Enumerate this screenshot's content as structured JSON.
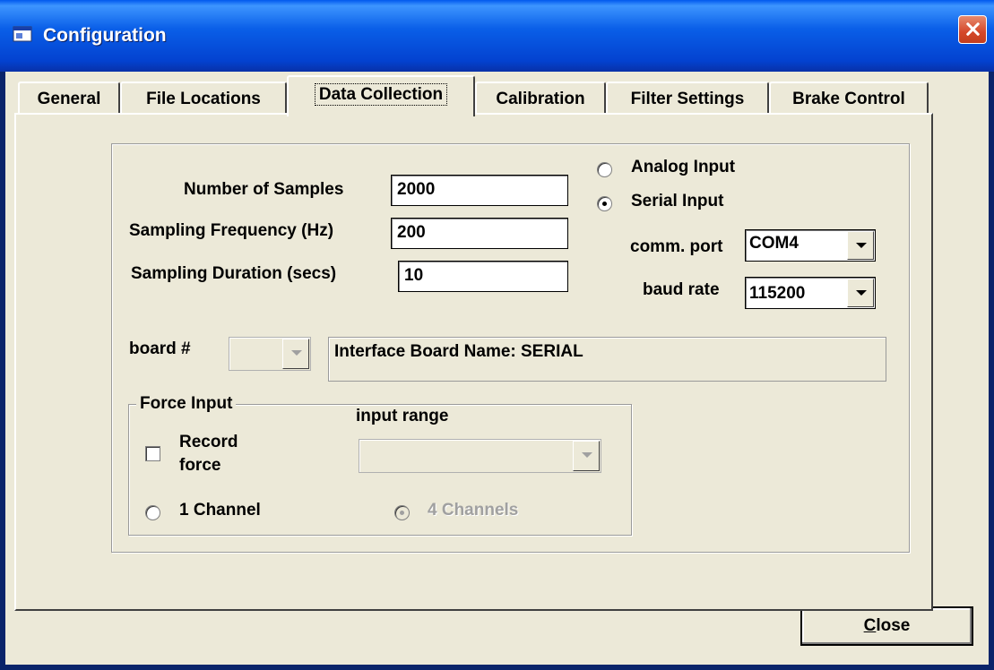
{
  "window": {
    "title": "Configuration",
    "icon": "app-icon",
    "close_icon": "close-icon"
  },
  "tabs": [
    {
      "label": "General"
    },
    {
      "label": "File Locations"
    },
    {
      "label": "Data Collection",
      "active": true
    },
    {
      "label": "Calibration"
    },
    {
      "label": "Filter Settings"
    },
    {
      "label": "Brake Control"
    }
  ],
  "sampling": {
    "num_samples_label": "Number of Samples",
    "num_samples_value": "2000",
    "frequency_label": "Sampling Frequency (Hz)",
    "frequency_value": "200",
    "duration_label": "Sampling Duration (secs)",
    "duration_value": "10"
  },
  "input_mode": {
    "analog_label": "Analog Input",
    "serial_label": "Serial Input",
    "selected": "serial"
  },
  "serial": {
    "comm_port_label": "comm. port",
    "comm_port_value": "COM4",
    "baud_rate_label": "baud rate",
    "baud_rate_value": "115200"
  },
  "board": {
    "label": "board #",
    "value": "",
    "name_text": "Interface Board Name: SERIAL"
  },
  "force_input": {
    "group_label": "Force Input",
    "record_force_label_line1": "Record",
    "record_force_label_line2": "force",
    "record_force_checked": false,
    "input_range_label": "input range",
    "input_range_value": "",
    "one_channel_label": "1 Channel",
    "four_channels_label": "4 Channels",
    "selected_channels": "4 Channels"
  },
  "footer": {
    "close_label_underlined": "C",
    "close_label_rest": "lose"
  },
  "colors": {
    "title_bar": "#0342D0",
    "face": "#ECE9D8",
    "close_red": "#D5482A"
  }
}
